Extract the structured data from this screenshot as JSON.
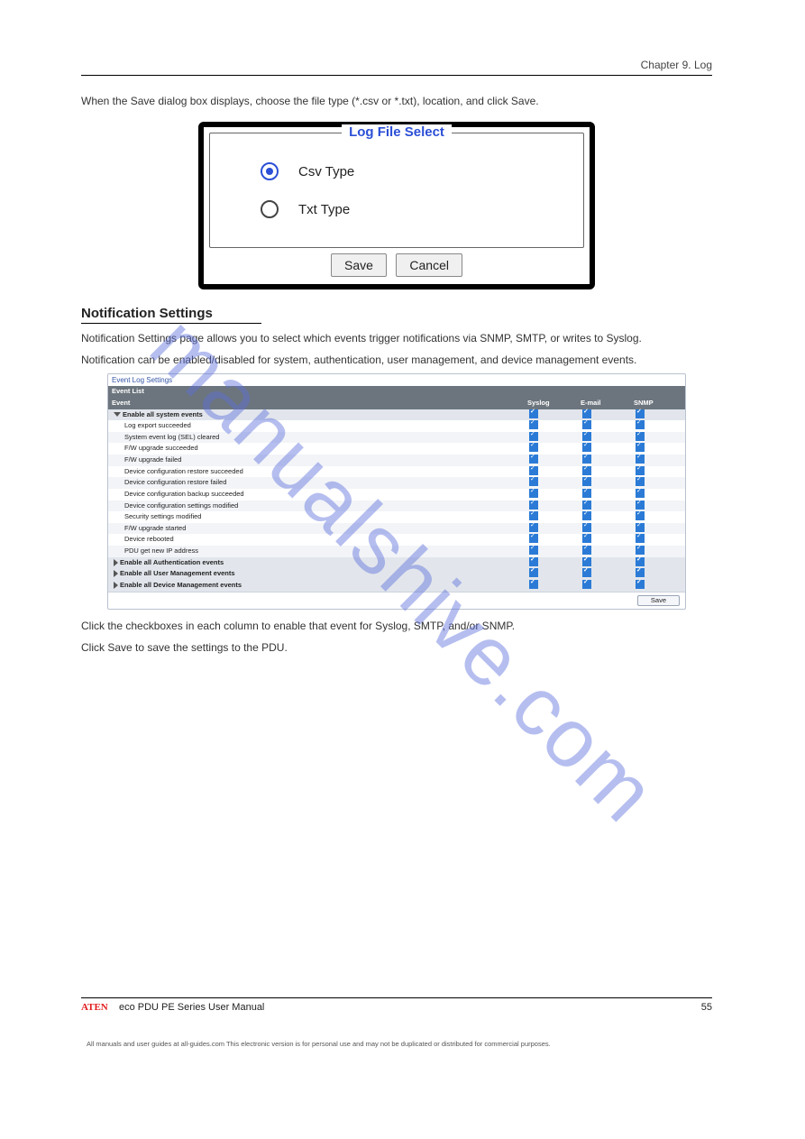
{
  "chapter": {
    "label": "Chapter 9. Log",
    "intro": "When the Save dialog box displays, choose the file type (*.csv or *.txt), location, and click Save."
  },
  "dialog": {
    "legend": "Log File Select",
    "opt_csv": "Csv Type",
    "opt_txt": "Txt Type",
    "btn_save": "Save",
    "btn_cancel": "Cancel"
  },
  "notifications": {
    "heading": "Notification Settings",
    "p1": "Notification Settings page allows you to select which events trigger notifications via SNMP, SMTP, or writes to Syslog.",
    "p2": "Notification can be enabled/disabled for system, authentication, user management, and device management events."
  },
  "els": {
    "title": "Event Log Settings",
    "eventlist": "Event List",
    "col_event": "Event",
    "col_syslog": "Syslog",
    "col_email": "E-mail",
    "col_snmp": "SNMP",
    "rows": [
      {
        "label": "Enable all system events",
        "group": true,
        "expanded": true
      },
      {
        "label": "Log export succeeded"
      },
      {
        "label": "System event log (SEL) cleared"
      },
      {
        "label": "F/W upgrade succeeded"
      },
      {
        "label": "F/W upgrade failed"
      },
      {
        "label": "Device configuration restore succeeded"
      },
      {
        "label": "Device configuration restore failed"
      },
      {
        "label": "Device configuration backup succeeded"
      },
      {
        "label": "Device configuration settings modified"
      },
      {
        "label": "Security settings modified"
      },
      {
        "label": "F/W upgrade started"
      },
      {
        "label": "Device rebooted"
      },
      {
        "label": "PDU get new IP address"
      },
      {
        "label": "Enable all Authentication events",
        "group": true,
        "expanded": false
      },
      {
        "label": "Enable all User Management events",
        "group": true,
        "expanded": false
      },
      {
        "label": "Enable all Device Management events",
        "group": true,
        "expanded": false
      }
    ],
    "save": "Save"
  },
  "tail": {
    "p1": "Click the checkboxes in each column to enable that event for Syslog, SMTP, and/or SNMP.",
    "p2": "Click Save to save the settings to the PDU."
  },
  "footer": {
    "brand": "ATEN",
    "left": "eco PDU PE Series User Manual",
    "right": "55"
  },
  "legal": "All manuals and user guides at all-guides.com\nThis electronic version is for personal use and may not be duplicated or distributed for commercial purposes.",
  "watermark": "manualshive.com"
}
